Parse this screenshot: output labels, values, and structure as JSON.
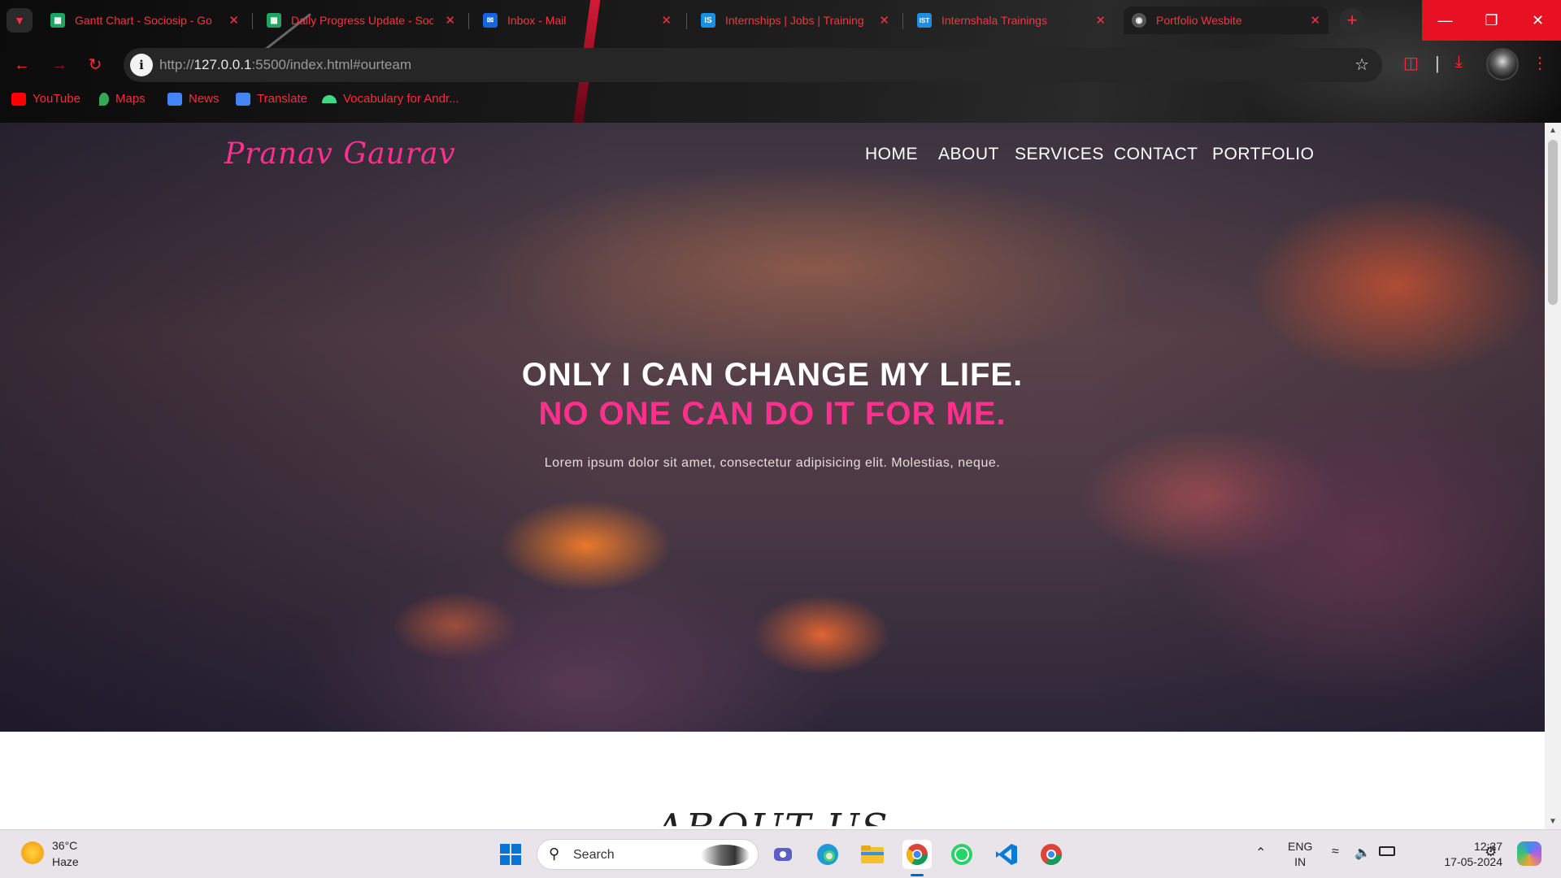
{
  "browser": {
    "tabs": [
      {
        "title": "Gantt Chart - Sociosip - Go",
        "icon": "google-sheets-icon",
        "color": "#1fa463"
      },
      {
        "title": "Daily Progress Update - Soc",
        "icon": "google-sheets-icon",
        "color": "#1fa463"
      },
      {
        "title": "Inbox - Mail",
        "icon": "mail-icon",
        "color": "#1565e0"
      },
      {
        "title": "Internships | Jobs | Training",
        "icon": "internshala-icon",
        "color": "#1a8fe3",
        "glyph": "IS"
      },
      {
        "title": "Internshala Trainings",
        "icon": "internshala-trainings-icon",
        "color": "#1a8fe3",
        "glyph": "IST"
      },
      {
        "title": "Portfolio Wesbite",
        "icon": "globe-icon",
        "color": "#777777",
        "active": true
      }
    ],
    "url_prefix": "http://",
    "url_host": "127.0.0.1",
    "url_rest": ":5500/index.html#ourteam",
    "bookmarks": [
      {
        "label": "YouTube",
        "icon": "youtube-icon",
        "color": "#ff0000"
      },
      {
        "label": "Maps",
        "icon": "maps-icon",
        "color": "#34a853"
      },
      {
        "label": "News",
        "icon": "news-icon",
        "color": "#4285f4"
      },
      {
        "label": "Translate",
        "icon": "translate-icon",
        "color": "#4285f4"
      },
      {
        "label": "Vocabulary for Andr...",
        "icon": "android-icon",
        "color": "#3ddc84"
      }
    ],
    "accent": "#ff2a3a"
  },
  "site": {
    "logo": "Pranav Gaurav",
    "nav": [
      "HOME",
      "ABOUT",
      "SERVICES",
      "CONTACT",
      "PORTFOLIO"
    ],
    "hero_line1": "ONLY I CAN CHANGE MY LIFE.",
    "hero_line2": "NO ONE CAN DO IT FOR ME.",
    "hero_text": "Lorem ipsum dolor sit amet, consectetur adipisicing elit. Molestias, neque.",
    "next_heading": "ABOUT US",
    "brand_color": "#ff2f8e"
  },
  "taskbar": {
    "weather_temp": "36°C",
    "weather_cond": "Haze",
    "search_placeholder": "Search",
    "apps": [
      "windows-start-icon",
      "teams-meet-icon",
      "edge-icon",
      "file-explorer-icon",
      "chrome-icon",
      "whatsapp-icon",
      "vscode-icon",
      "chrome-profile-icon"
    ],
    "lang_line1": "ENG",
    "lang_line2": "IN",
    "time": "12:37",
    "date": "17-05-2024"
  }
}
